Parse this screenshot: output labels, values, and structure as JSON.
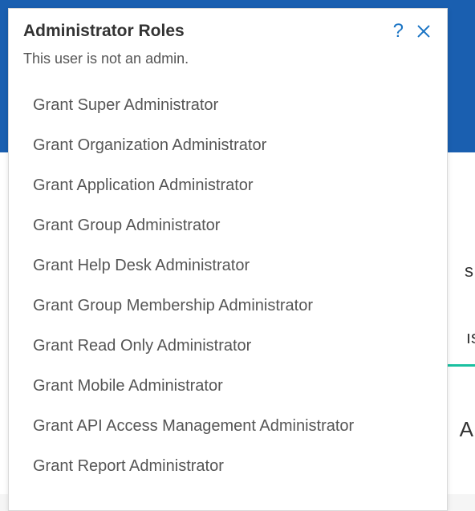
{
  "popover": {
    "title": "Administrator Roles",
    "subtitle": "This user is not an admin.",
    "roles": [
      {
        "label": "Grant Super Administrator"
      },
      {
        "label": "Grant Organization Administrator"
      },
      {
        "label": "Grant Application Administrator"
      },
      {
        "label": "Grant Group Administrator"
      },
      {
        "label": "Grant Help Desk Administrator"
      },
      {
        "label": "Grant Group Membership Administrator"
      },
      {
        "label": "Grant Read Only Administrator"
      },
      {
        "label": "Grant Mobile Administrator"
      },
      {
        "label": "Grant API Access Management Administrator"
      },
      {
        "label": "Grant Report Administrator"
      }
    ]
  },
  "background": {
    "fragment_s": "s",
    "fragment_ns": "ıs",
    "fragment_A": "A"
  }
}
